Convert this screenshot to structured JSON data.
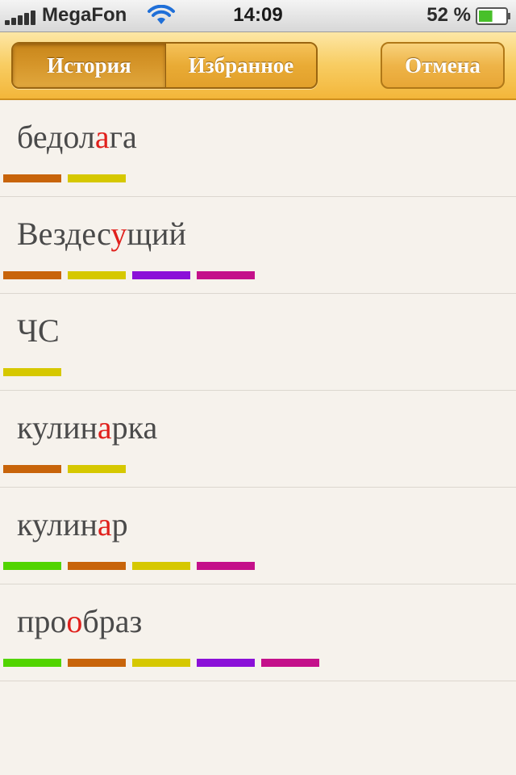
{
  "status_bar": {
    "carrier": "MegaFon",
    "time": "14:09",
    "battery_percent": "52 %",
    "battery_level": 0.52,
    "icons": [
      "signal-icon",
      "wifi-icon",
      "battery-icon"
    ]
  },
  "toolbar": {
    "segments": [
      {
        "label": "История",
        "selected": true
      },
      {
        "label": "Избранное",
        "selected": false
      }
    ],
    "cancel_label": "Отмена"
  },
  "colors": {
    "stress": "#e0201c",
    "orange": "#c8640a",
    "yellow": "#d6c800",
    "purple": "#8b10d8",
    "magenta": "#c4108a",
    "green": "#52d400"
  },
  "words": [
    {
      "before": "бедол",
      "stress": "а",
      "after": "га",
      "tags": [
        "orange",
        "yellow"
      ]
    },
    {
      "before": "Вездес",
      "stress": "у",
      "after": "щий",
      "tags": [
        "orange",
        "yellow",
        "purple",
        "magenta"
      ]
    },
    {
      "before": "ЧС",
      "stress": "",
      "after": "",
      "tags": [
        "yellow"
      ]
    },
    {
      "before": "кулин",
      "stress": "а",
      "after": "рка",
      "tags": [
        "orange",
        "yellow"
      ]
    },
    {
      "before": "кулин",
      "stress": "а",
      "after": "р",
      "tags": [
        "green",
        "orange",
        "yellow",
        "magenta"
      ]
    },
    {
      "before": "про",
      "stress": "о",
      "after": "браз",
      "tags": [
        "green",
        "orange",
        "yellow",
        "purple",
        "magenta"
      ]
    }
  ]
}
